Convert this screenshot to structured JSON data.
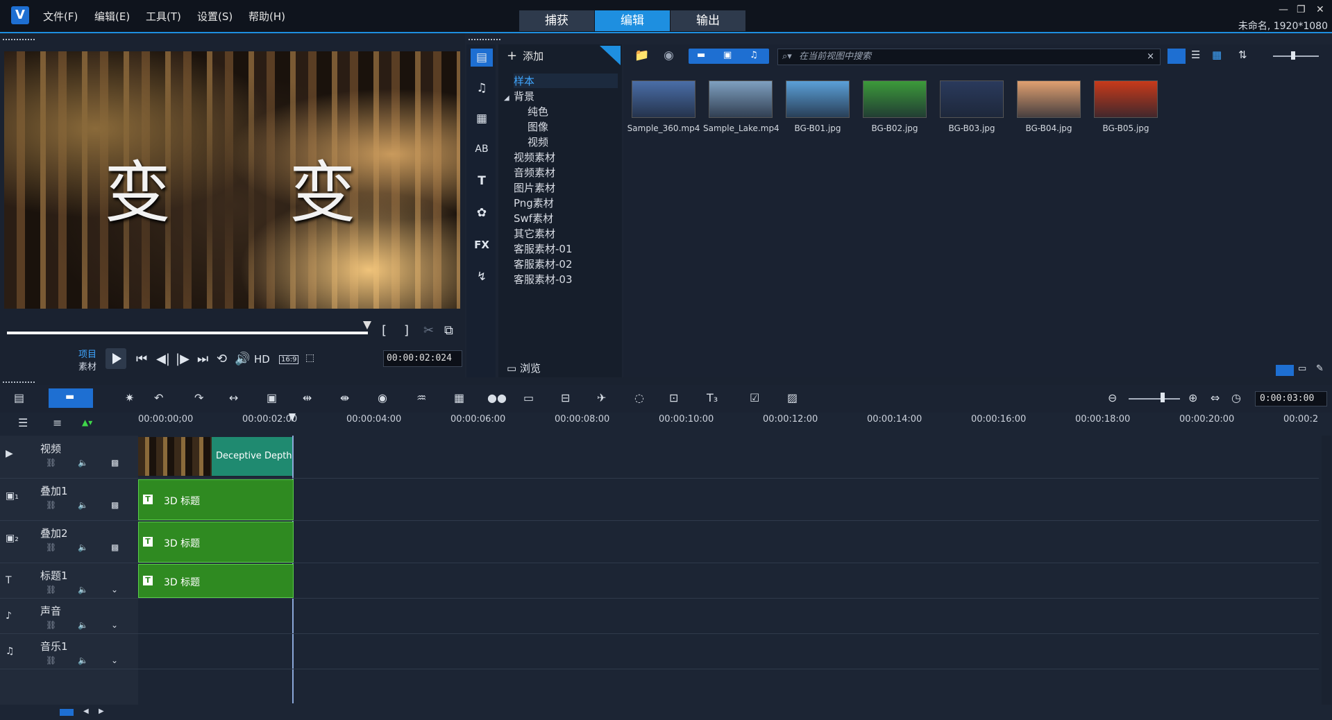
{
  "menu": {
    "logo": "V",
    "items": [
      "文件(F)",
      "编辑(E)",
      "工具(T)",
      "设置(S)",
      "帮助(H)"
    ]
  },
  "mode_tabs": [
    "捕获",
    "编辑",
    "输出"
  ],
  "window_buttons": [
    "—",
    "❐",
    "✕"
  ],
  "project_info": "未命名, 1920*1080",
  "preview": {
    "overlay_text": "变 变 变",
    "mode_project": "项目",
    "mode_clip": "素材",
    "hd_label": "HD",
    "aspect": "16:9",
    "timecode": "00:00:02:024"
  },
  "library": {
    "add_label": "添加",
    "browse_label": "浏览",
    "search_placeholder": "在当前视图中搜索",
    "tree": [
      {
        "label": "样本",
        "selected": true,
        "indent": 0
      },
      {
        "label": "背景",
        "selected": false,
        "indent": 0
      },
      {
        "label": "纯色",
        "selected": false,
        "indent": 1
      },
      {
        "label": "图像",
        "selected": false,
        "indent": 1
      },
      {
        "label": "视频",
        "selected": false,
        "indent": 1
      },
      {
        "label": "视频素材",
        "selected": false,
        "indent": 0
      },
      {
        "label": "音频素材",
        "selected": false,
        "indent": 0
      },
      {
        "label": "图片素材",
        "selected": false,
        "indent": 0
      },
      {
        "label": "Png素材",
        "selected": false,
        "indent": 0
      },
      {
        "label": "Swf素材",
        "selected": false,
        "indent": 0
      },
      {
        "label": "其它素材",
        "selected": false,
        "indent": 0
      },
      {
        "label": "客服素材-01",
        "selected": false,
        "indent": 0
      },
      {
        "label": "客服素材-02",
        "selected": false,
        "indent": 0
      },
      {
        "label": "客服素材-03",
        "selected": false,
        "indent": 0
      }
    ],
    "thumbnails": [
      {
        "caption": "Sample_360.mp4",
        "color": "#4a6ea8"
      },
      {
        "caption": "Sample_Lake.mp4",
        "color": "#7fa0c0"
      },
      {
        "caption": "BG-B01.jpg",
        "color": "#5ba0d8"
      },
      {
        "caption": "BG-B02.jpg",
        "color": "#3c9a3a"
      },
      {
        "caption": "BG-B03.jpg",
        "color": "#2a3a5c"
      },
      {
        "caption": "BG-B04.jpg",
        "color": "#e0a070"
      },
      {
        "caption": "BG-B05.jpg",
        "color": "#c83a1a"
      }
    ]
  },
  "timeline": {
    "zoom_timecode": "0:00:03:00",
    "ruler": [
      "00:00:00;00",
      "00:00:02:00",
      "00:00:04:00",
      "00:00:06:00",
      "00:00:08:00",
      "00:00:10:00",
      "00:00:12:00",
      "00:00:14:00",
      "00:00:16:00",
      "00:00:18:00",
      "00:00:20:00",
      "00:00:2"
    ],
    "tracks": [
      {
        "name": "视频",
        "clip": "Deceptive Depth.m"
      },
      {
        "name": "叠加1",
        "clip": "3D 标题"
      },
      {
        "name": "叠加2",
        "clip": "3D 标题"
      },
      {
        "name": "标题1",
        "clip": "3D 标题"
      },
      {
        "name": "声音",
        "clip": ""
      },
      {
        "name": "音乐1",
        "clip": ""
      }
    ]
  }
}
